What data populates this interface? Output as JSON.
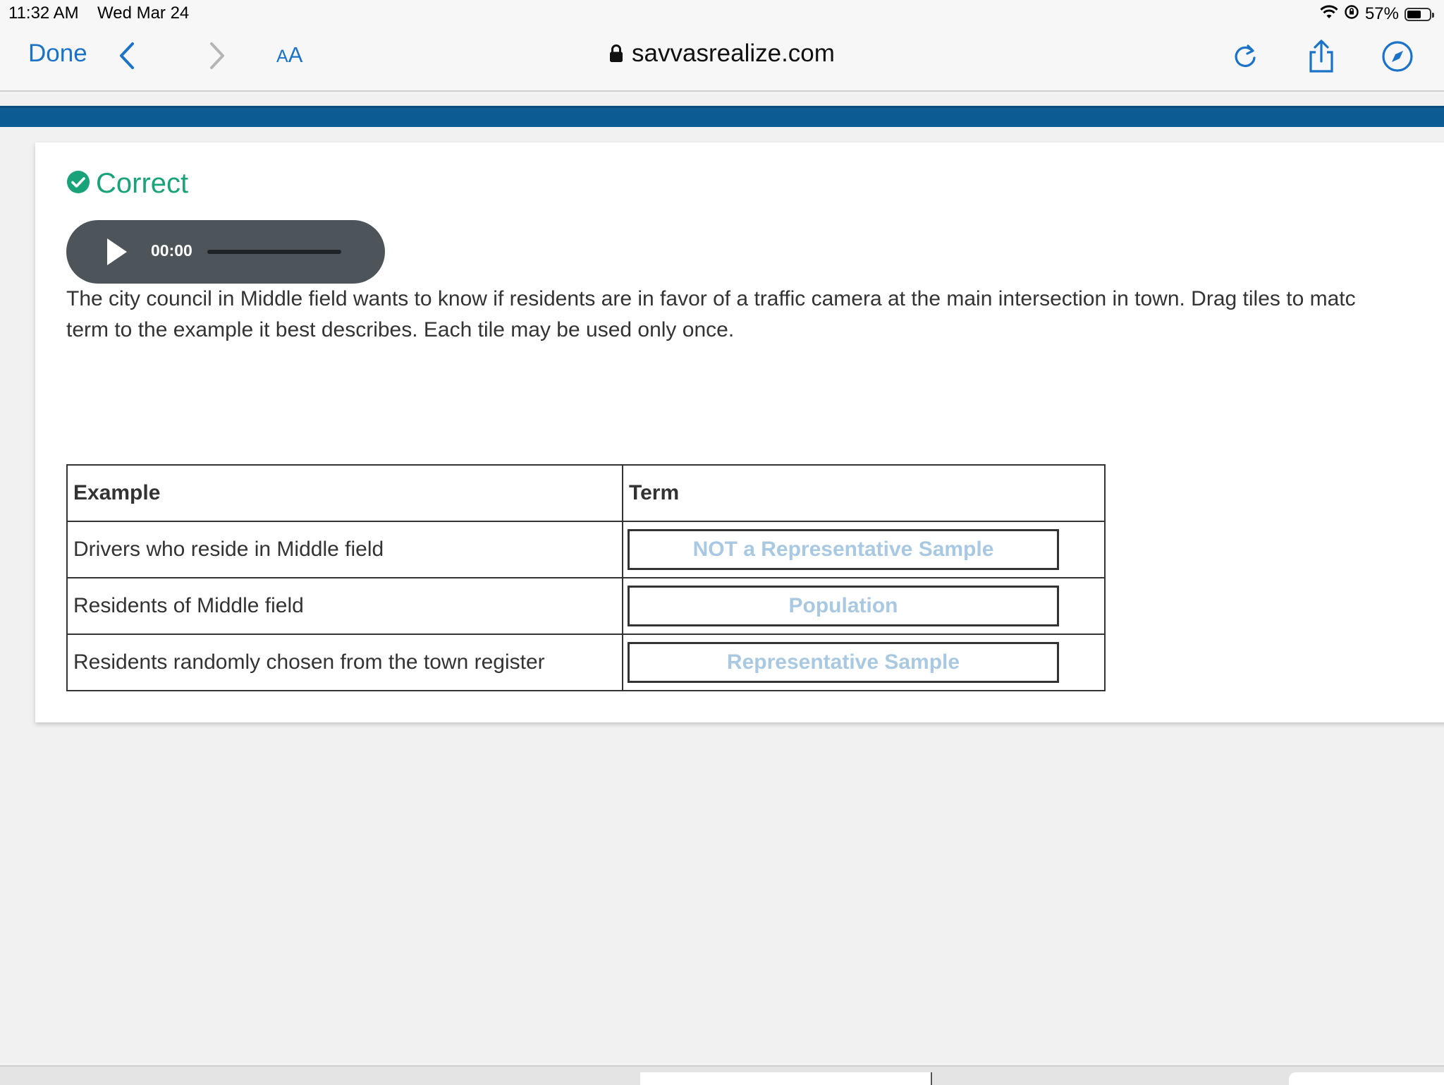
{
  "status_bar": {
    "time": "11:32 AM",
    "date": "Wed Mar 24",
    "battery_percent": "57%",
    "battery_level": 0.57
  },
  "browser": {
    "done_label": "Done",
    "text_size_label_small": "A",
    "text_size_label_big": "A",
    "url": "savvasrealize.com",
    "accent_color": "#1a73c9"
  },
  "feedback": {
    "label": "Correct",
    "color": "#1aa37a"
  },
  "audio_player": {
    "time": "00:00"
  },
  "question": {
    "prompt": "The city council in Middle field wants to know if residents are in favor of a traffic camera at the main intersection in town. Drag tiles to matc",
    "prompt_line2": "term to the example it best describes. Each tile may be used only once."
  },
  "table": {
    "headers": [
      "Example",
      "Term"
    ],
    "rows": [
      {
        "example": "Drivers who reside in Middle field",
        "term": "NOT a Representative Sample"
      },
      {
        "example": "Residents of Middle field",
        "term": "Population"
      },
      {
        "example": "Residents randomly chosen from the town register",
        "term": "Representative Sample"
      }
    ]
  }
}
